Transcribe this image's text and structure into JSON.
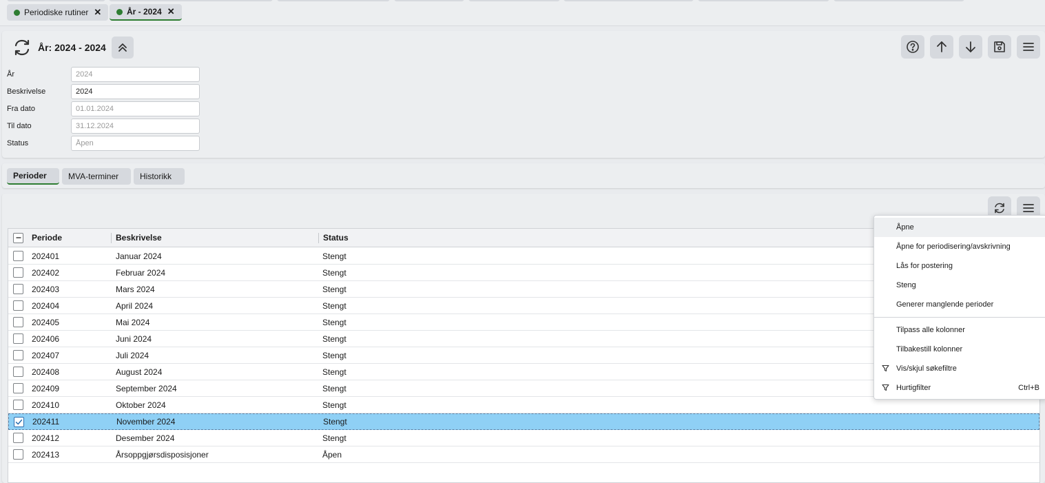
{
  "tabs": [
    {
      "label": "Periodiske rutiner",
      "active": false
    },
    {
      "label": "År - 2024",
      "active": true
    }
  ],
  "header": {
    "title": "År: 2024 - 2024"
  },
  "form": {
    "year_label": "År",
    "year_value": "2024",
    "description_label": "Beskrivelse",
    "description_value": "2024",
    "from_label": "Fra dato",
    "from_value": "01.01.2024",
    "to_label": "Til dato",
    "to_value": "31.12.2024",
    "status_label": "Status",
    "status_value": "Åpen"
  },
  "subtabs": [
    {
      "label": "Perioder",
      "active": true
    },
    {
      "label": "MVA-terminer",
      "active": false
    },
    {
      "label": "Historikk",
      "active": false
    }
  ],
  "grid": {
    "columns": [
      "Periode",
      "Beskrivelse",
      "Status"
    ],
    "rows": [
      {
        "periode": "202401",
        "beskrivelse": "Januar 2024",
        "status": "Stengt",
        "selected": false
      },
      {
        "periode": "202402",
        "beskrivelse": "Februar 2024",
        "status": "Stengt",
        "selected": false
      },
      {
        "periode": "202403",
        "beskrivelse": "Mars 2024",
        "status": "Stengt",
        "selected": false
      },
      {
        "periode": "202404",
        "beskrivelse": "April 2024",
        "status": "Stengt",
        "selected": false
      },
      {
        "periode": "202405",
        "beskrivelse": "Mai 2024",
        "status": "Stengt",
        "selected": false
      },
      {
        "periode": "202406",
        "beskrivelse": "Juni 2024",
        "status": "Stengt",
        "selected": false
      },
      {
        "periode": "202407",
        "beskrivelse": "Juli 2024",
        "status": "Stengt",
        "selected": false
      },
      {
        "periode": "202408",
        "beskrivelse": "August 2024",
        "status": "Stengt",
        "selected": false
      },
      {
        "periode": "202409",
        "beskrivelse": "September 2024",
        "status": "Stengt",
        "selected": false
      },
      {
        "periode": "202410",
        "beskrivelse": "Oktober 2024",
        "status": "Stengt",
        "selected": false
      },
      {
        "periode": "202411",
        "beskrivelse": "November 2024",
        "status": "Stengt",
        "selected": true
      },
      {
        "periode": "202412",
        "beskrivelse": "Desember 2024",
        "status": "Stengt",
        "selected": false
      },
      {
        "periode": "202413",
        "beskrivelse": "Årsoppgjørsdisposisjoner",
        "status": "Åpen",
        "selected": false
      }
    ]
  },
  "context_menu": {
    "items": [
      {
        "label": "Åpne",
        "icon": ""
      },
      {
        "label": "Åpne for periodisering/avskrivning",
        "icon": ""
      },
      {
        "label": "Lås for postering",
        "icon": ""
      },
      {
        "label": "Steng",
        "icon": ""
      },
      {
        "label": "Generer manglende perioder",
        "icon": ""
      },
      {
        "label": "Tilpass alle kolonner",
        "icon": ""
      },
      {
        "label": "Tilbakestill kolonner",
        "icon": ""
      },
      {
        "label": "Vis/skjul søkefiltre",
        "icon": "filter-icon"
      },
      {
        "label": "Hurtigfilter",
        "icon": "filter-icon",
        "shortcut": "Ctrl+B"
      }
    ]
  },
  "colors": {
    "accent_green": "#2e7d32",
    "selected_row": "#8fd0f5"
  }
}
